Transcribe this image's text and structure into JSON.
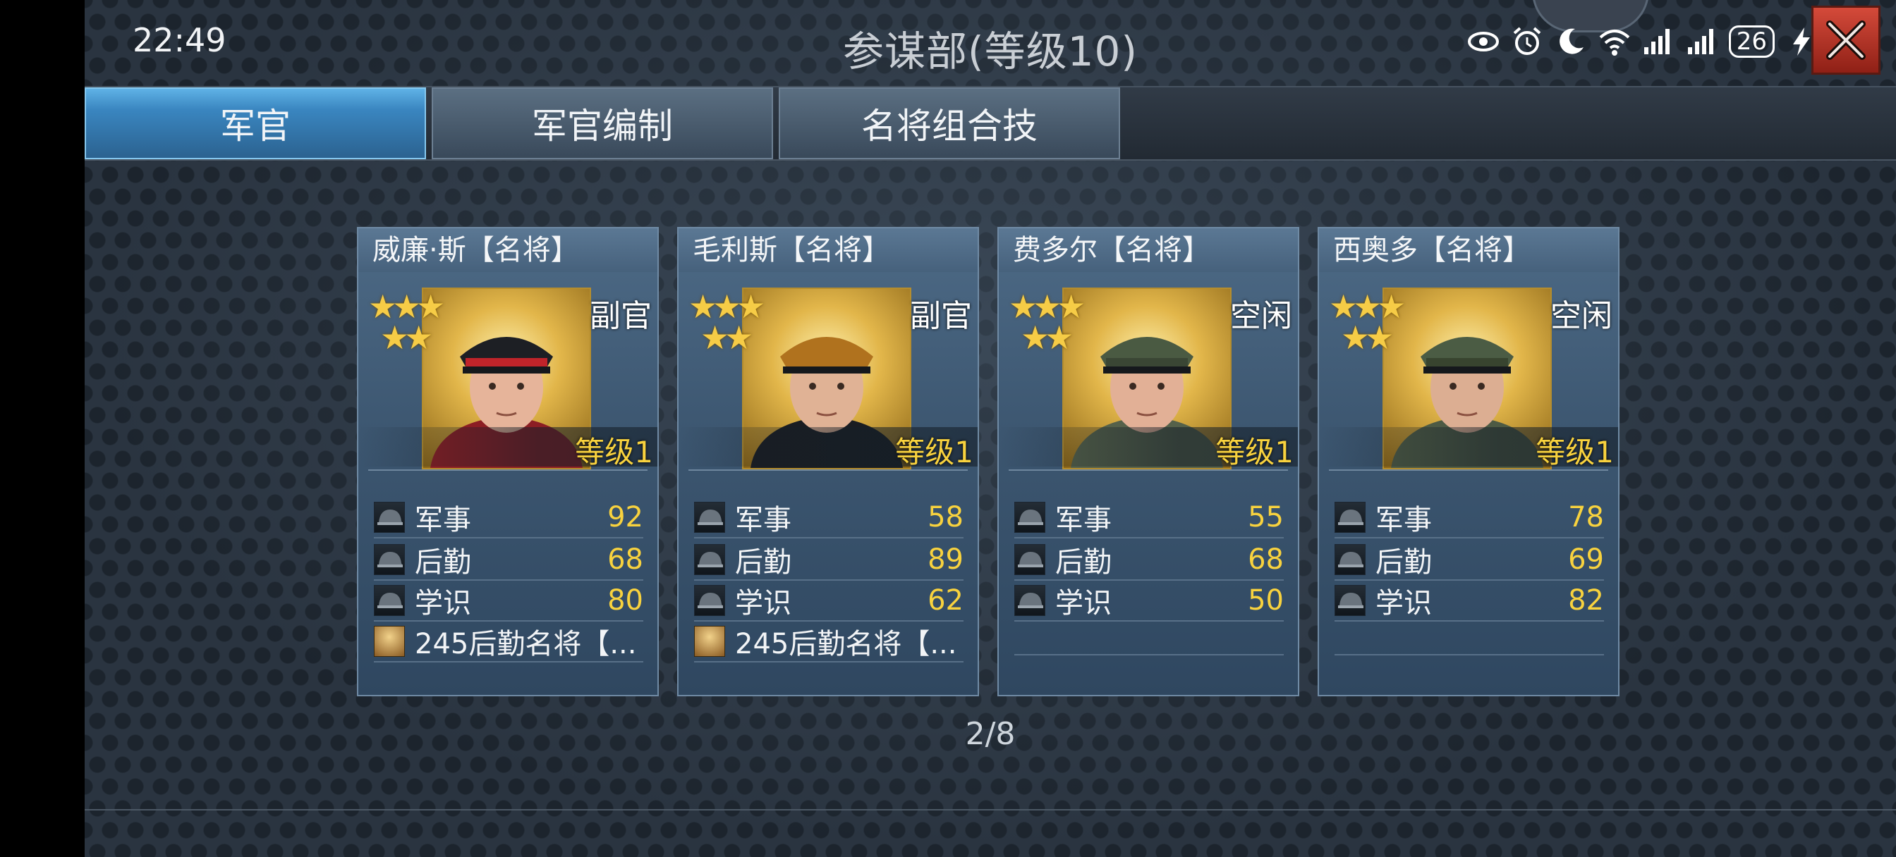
{
  "status_bar": {
    "time": "22:49",
    "battery": "26",
    "icons": [
      "eye-icon",
      "alarm-icon",
      "moon-icon",
      "wifi-icon",
      "signal-icon",
      "signal-icon",
      "battery-icon",
      "charging-icon"
    ]
  },
  "header": {
    "title": "参谋部(等级10)",
    "close_icon": "close-icon"
  },
  "tabs": [
    {
      "label": "军官",
      "active": true
    },
    {
      "label": "军官编制",
      "active": false
    },
    {
      "label": "名将组合技",
      "active": false
    }
  ],
  "officers": [
    {
      "name": "威廉·斯【名将】",
      "stars": 5,
      "status": "副官",
      "level": "等级1",
      "stats": [
        {
          "label": "军事",
          "value": "92",
          "icon": "military-helmet-icon"
        },
        {
          "label": "后勤",
          "value": "68",
          "icon": "logistics-helmet-icon"
        },
        {
          "label": "学识",
          "value": "80",
          "icon": "knowledge-cap-icon"
        }
      ],
      "skill": "245后勤名将【..."
    },
    {
      "name": "毛利斯【名将】",
      "stars": 5,
      "status": "副官",
      "level": "等级1",
      "stats": [
        {
          "label": "军事",
          "value": "58",
          "icon": "military-helmet-icon"
        },
        {
          "label": "后勤",
          "value": "89",
          "icon": "logistics-helmet-icon"
        },
        {
          "label": "学识",
          "value": "62",
          "icon": "knowledge-cap-icon"
        }
      ],
      "skill": "245后勤名将【..."
    },
    {
      "name": "费多尔【名将】",
      "stars": 5,
      "status": "空闲",
      "level": "等级1",
      "stats": [
        {
          "label": "军事",
          "value": "55",
          "icon": "military-helmet-icon"
        },
        {
          "label": "后勤",
          "value": "68",
          "icon": "logistics-helmet-icon"
        },
        {
          "label": "学识",
          "value": "50",
          "icon": "knowledge-cap-icon"
        }
      ],
      "skill": ""
    },
    {
      "name": "西奥多【名将】",
      "stars": 5,
      "status": "空闲",
      "level": "等级1",
      "stats": [
        {
          "label": "军事",
          "value": "78",
          "icon": "military-helmet-icon"
        },
        {
          "label": "后勤",
          "value": "69",
          "icon": "logistics-helmet-icon"
        },
        {
          "label": "学识",
          "value": "82",
          "icon": "knowledge-cap-icon"
        }
      ],
      "skill": ""
    }
  ],
  "pager": "2/8"
}
